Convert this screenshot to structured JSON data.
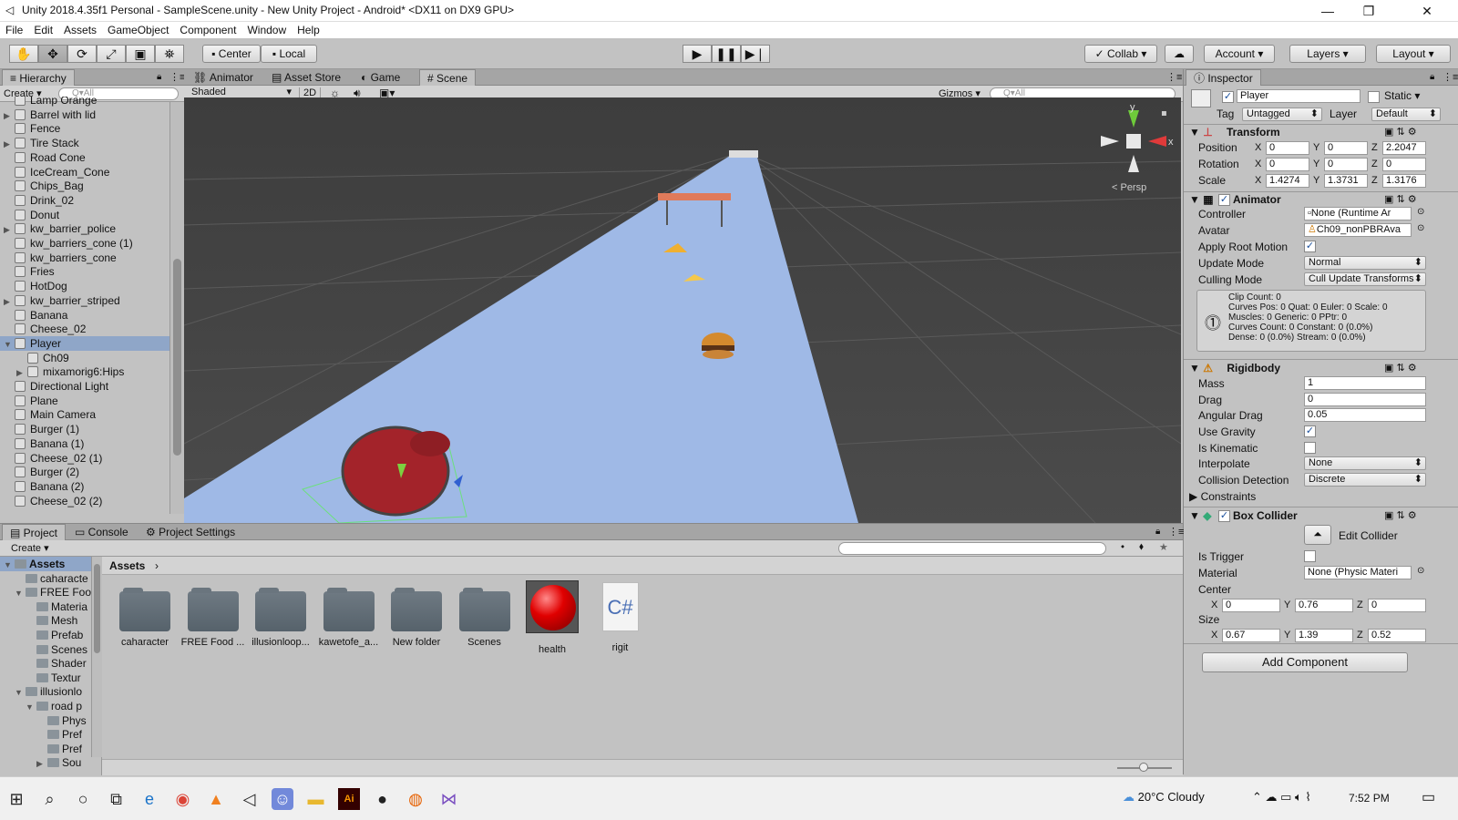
{
  "window": {
    "title": "Unity 2018.4.35f1 Personal - SampleScene.unity - New Unity Project - Android* <DX11 on DX9 GPU>",
    "minimize": "—",
    "maximize": "❐",
    "close": "✕"
  },
  "menu": [
    "File",
    "Edit",
    "Assets",
    "GameObject",
    "Component",
    "Window",
    "Help"
  ],
  "toolbar": {
    "pivot": "Center",
    "space": "Local",
    "collab": "Collab",
    "account": "Account",
    "layers": "Layers",
    "layout": "Layout"
  },
  "hierarchy": {
    "tab": "Hierarchy",
    "create": "Create",
    "search_placeholder": "Q▾All",
    "items": [
      {
        "label": "Lamp Orange",
        "arrow": ""
      },
      {
        "label": "Barrel with lid",
        "arrow": "▶"
      },
      {
        "label": "Fence",
        "arrow": ""
      },
      {
        "label": "Tire Stack",
        "arrow": "▶"
      },
      {
        "label": "Road Cone",
        "arrow": ""
      },
      {
        "label": "IceCream_Cone",
        "arrow": ""
      },
      {
        "label": "Chips_Bag",
        "arrow": ""
      },
      {
        "label": "Drink_02",
        "arrow": ""
      },
      {
        "label": "Donut",
        "arrow": ""
      },
      {
        "label": "kw_barrier_police",
        "arrow": "▶"
      },
      {
        "label": "kw_barriers_cone (1)",
        "arrow": ""
      },
      {
        "label": "kw_barriers_cone",
        "arrow": ""
      },
      {
        "label": "Fries",
        "arrow": ""
      },
      {
        "label": "HotDog",
        "arrow": ""
      },
      {
        "label": "kw_barrier_striped",
        "arrow": "▶"
      },
      {
        "label": "Banana",
        "arrow": ""
      },
      {
        "label": "Cheese_02",
        "arrow": ""
      },
      {
        "label": "Player",
        "arrow": "▼"
      },
      {
        "label": "Ch09",
        "arrow": ""
      },
      {
        "label": "mixamorig6:Hips",
        "arrow": "▶"
      },
      {
        "label": "Directional Light",
        "arrow": ""
      },
      {
        "label": "Plane",
        "arrow": ""
      },
      {
        "label": "Main Camera",
        "arrow": ""
      },
      {
        "label": "Burger (1)",
        "arrow": ""
      },
      {
        "label": "Banana (1)",
        "arrow": ""
      },
      {
        "label": "Cheese_02 (1)",
        "arrow": ""
      },
      {
        "label": "Burger (2)",
        "arrow": ""
      },
      {
        "label": "Banana (2)",
        "arrow": ""
      },
      {
        "label": "Cheese_02 (2)",
        "arrow": ""
      }
    ]
  },
  "center_tabs": [
    {
      "label": "Animator",
      "icon": "animator-icon"
    },
    {
      "label": "Asset Store",
      "icon": "store-icon"
    },
    {
      "label": "Game",
      "icon": "game-icon"
    },
    {
      "label": "Scene",
      "icon": "scene-icon"
    }
  ],
  "scene": {
    "shading": "Shaded",
    "mode2d": "2D",
    "gizmos": "Gizmos",
    "search_placeholder": "Q▾All",
    "persp": "< Persp",
    "axis_y": "y",
    "axis_x": "x"
  },
  "inspector": {
    "tab": "Inspector",
    "object_name": "Player",
    "static_label": "Static",
    "tag_label": "Tag",
    "tag_value": "Untagged",
    "layer_label": "Layer",
    "layer_value": "Default",
    "transform": {
      "title": "Transform",
      "position_label": "Position",
      "px": "0",
      "py": "0",
      "pz": "2.2047",
      "rotation_label": "Rotation",
      "rx": "0",
      "ry": "0",
      "rz": "0",
      "scale_label": "Scale",
      "sx": "1.4274",
      "sy": "1.3731",
      "sz": "1.3176"
    },
    "animator": {
      "title": "Animator",
      "controller_label": "Controller",
      "controller_value": "None (Runtime Ar",
      "avatar_label": "Avatar",
      "avatar_value": "Ch09_nonPBRAva",
      "root_motion_label": "Apply Root Motion",
      "update_mode_label": "Update Mode",
      "update_mode_value": "Normal",
      "culling_label": "Culling Mode",
      "culling_value": "Cull Update Transforms",
      "info": [
        "Clip Count: 0",
        "Curves Pos: 0 Quat: 0 Euler: 0 Scale: 0",
        "Muscles: 0 Generic: 0 PPtr: 0",
        "Curves Count: 0 Constant: 0 (0.0%)",
        "Dense: 0 (0.0%) Stream: 0 (0.0%)"
      ]
    },
    "rigidbody": {
      "title": "Rigidbody",
      "mass_label": "Mass",
      "mass_value": "1",
      "drag_label": "Drag",
      "drag_value": "0",
      "angular_label": "Angular Drag",
      "angular_value": "0.05",
      "gravity_label": "Use Gravity",
      "kinematic_label": "Is Kinematic",
      "interp_label": "Interpolate",
      "interp_value": "None",
      "collision_label": "Collision Detection",
      "collision_value": "Discrete",
      "constraints_label": "Constraints"
    },
    "box_collider": {
      "title": "Box Collider",
      "edit_label": "Edit Collider",
      "trigger_label": "Is Trigger",
      "material_label": "Material",
      "material_value": "None (Physic Materi",
      "center_label": "Center",
      "cx": "0",
      "cy": "0.76",
      "cz": "0",
      "size_label": "Size",
      "sx": "0.67",
      "sy": "1.39",
      "sz": "0.52"
    },
    "add_component": "Add Component"
  },
  "bottom_tabs": [
    {
      "label": "Project",
      "icon": "project-icon"
    },
    {
      "label": "Console",
      "icon": "console-icon"
    },
    {
      "label": "Project Settings",
      "icon": "gear-icon"
    }
  ],
  "project": {
    "create": "Create",
    "tree": [
      {
        "label": "Assets",
        "indent": 0,
        "arrow": "▼"
      },
      {
        "label": "caharacte",
        "indent": 1,
        "arrow": ""
      },
      {
        "label": "FREE Foo",
        "indent": 1,
        "arrow": "▼"
      },
      {
        "label": "Materia",
        "indent": 2,
        "arrow": ""
      },
      {
        "label": "Mesh",
        "indent": 2,
        "arrow": ""
      },
      {
        "label": "Prefab",
        "indent": 2,
        "arrow": ""
      },
      {
        "label": "Scenes",
        "indent": 2,
        "arrow": ""
      },
      {
        "label": "Shader",
        "indent": 2,
        "arrow": ""
      },
      {
        "label": "Textur",
        "indent": 2,
        "arrow": ""
      },
      {
        "label": "illusionlo",
        "indent": 1,
        "arrow": "▼"
      },
      {
        "label": "road p",
        "indent": 2,
        "arrow": "▼"
      },
      {
        "label": "Phys",
        "indent": 3,
        "arrow": ""
      },
      {
        "label": "Pref",
        "indent": 3,
        "arrow": ""
      },
      {
        "label": "Pref",
        "indent": 3,
        "arrow": ""
      },
      {
        "label": "Sou",
        "indent": 3,
        "arrow": "▶"
      }
    ],
    "breadcrumb": "Assets",
    "assets": [
      {
        "label": "caharacter",
        "kind": "folder"
      },
      {
        "label": "FREE Food ...",
        "kind": "folder"
      },
      {
        "label": "illusionloop...",
        "kind": "folder"
      },
      {
        "label": "kawetofe_a...",
        "kind": "folder"
      },
      {
        "label": "New folder",
        "kind": "folder"
      },
      {
        "label": "Scenes",
        "kind": "folder"
      },
      {
        "label": "health",
        "kind": "material"
      },
      {
        "label": "rigit",
        "kind": "script"
      }
    ],
    "script_glyph": "C#"
  },
  "taskbar": {
    "weather": "20°C  Cloudy",
    "time": "7:52 PM",
    "icons": [
      "windows-start-icon",
      "search-icon",
      "cortana-icon",
      "task-view-icon",
      "edge-icon",
      "chrome-icon",
      "vlc-icon",
      "unity-icon",
      "discord-icon",
      "file-explorer-icon",
      "illustrator-icon",
      "unity-hub-icon",
      "firefox-icon",
      "visual-studio-icon"
    ]
  },
  "colors": {
    "editor_bg": "#c2c2c2",
    "scene_bg": "#474747",
    "road": "#9fb9e6",
    "selection": "#8fa6c8",
    "health_sphere": "#d40000"
  }
}
